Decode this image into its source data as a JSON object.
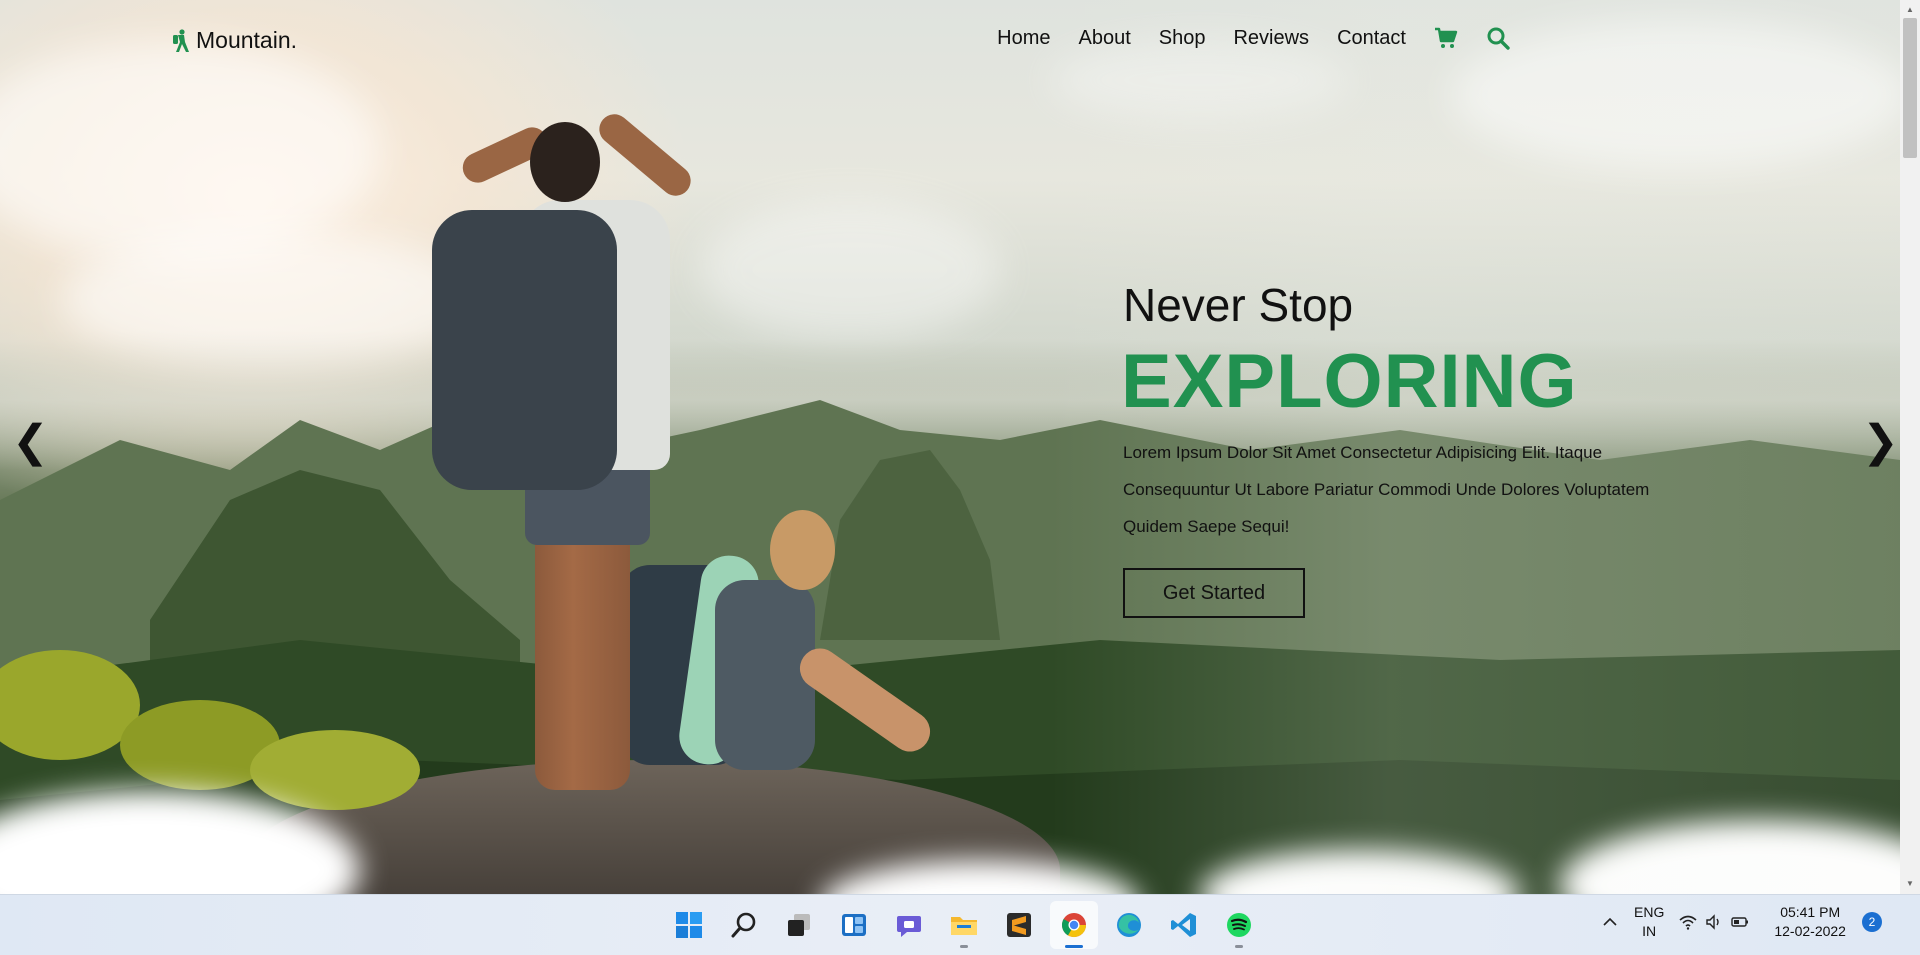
{
  "site": {
    "logo_text": "Mountain."
  },
  "nav": {
    "items": [
      {
        "label": "Home"
      },
      {
        "label": "About"
      },
      {
        "label": "Shop"
      },
      {
        "label": "Reviews"
      },
      {
        "label": "Contact"
      }
    ],
    "cart_icon": "cart-icon",
    "search_icon": "search-icon"
  },
  "hero": {
    "subtitle": "Never Stop",
    "title": "EXPLORING",
    "description": "Lorem Ipsum Dolor Sit Amet Consectetur Adipisicing Elit. Itaque Consequuntur Ut Labore Pariatur Commodi Unde Dolores Voluptatem Quidem Saepe Sequi!",
    "cta_label": "Get Started",
    "prev_arrow": "❮",
    "next_arrow": "❯"
  },
  "colors": {
    "accent": "#219150",
    "text": "#111111"
  },
  "taskbar": {
    "apps": [
      "windows-start",
      "search",
      "task-view",
      "widgets",
      "teams-chat",
      "file-explorer",
      "sublime-text",
      "chrome",
      "edge",
      "vs-code",
      "spotify"
    ],
    "active_app": "chrome",
    "tray": {
      "lang_line1": "ENG",
      "lang_line2": "IN",
      "time": "05:41 PM",
      "date": "12-02-2022",
      "notification_count": "2"
    }
  }
}
